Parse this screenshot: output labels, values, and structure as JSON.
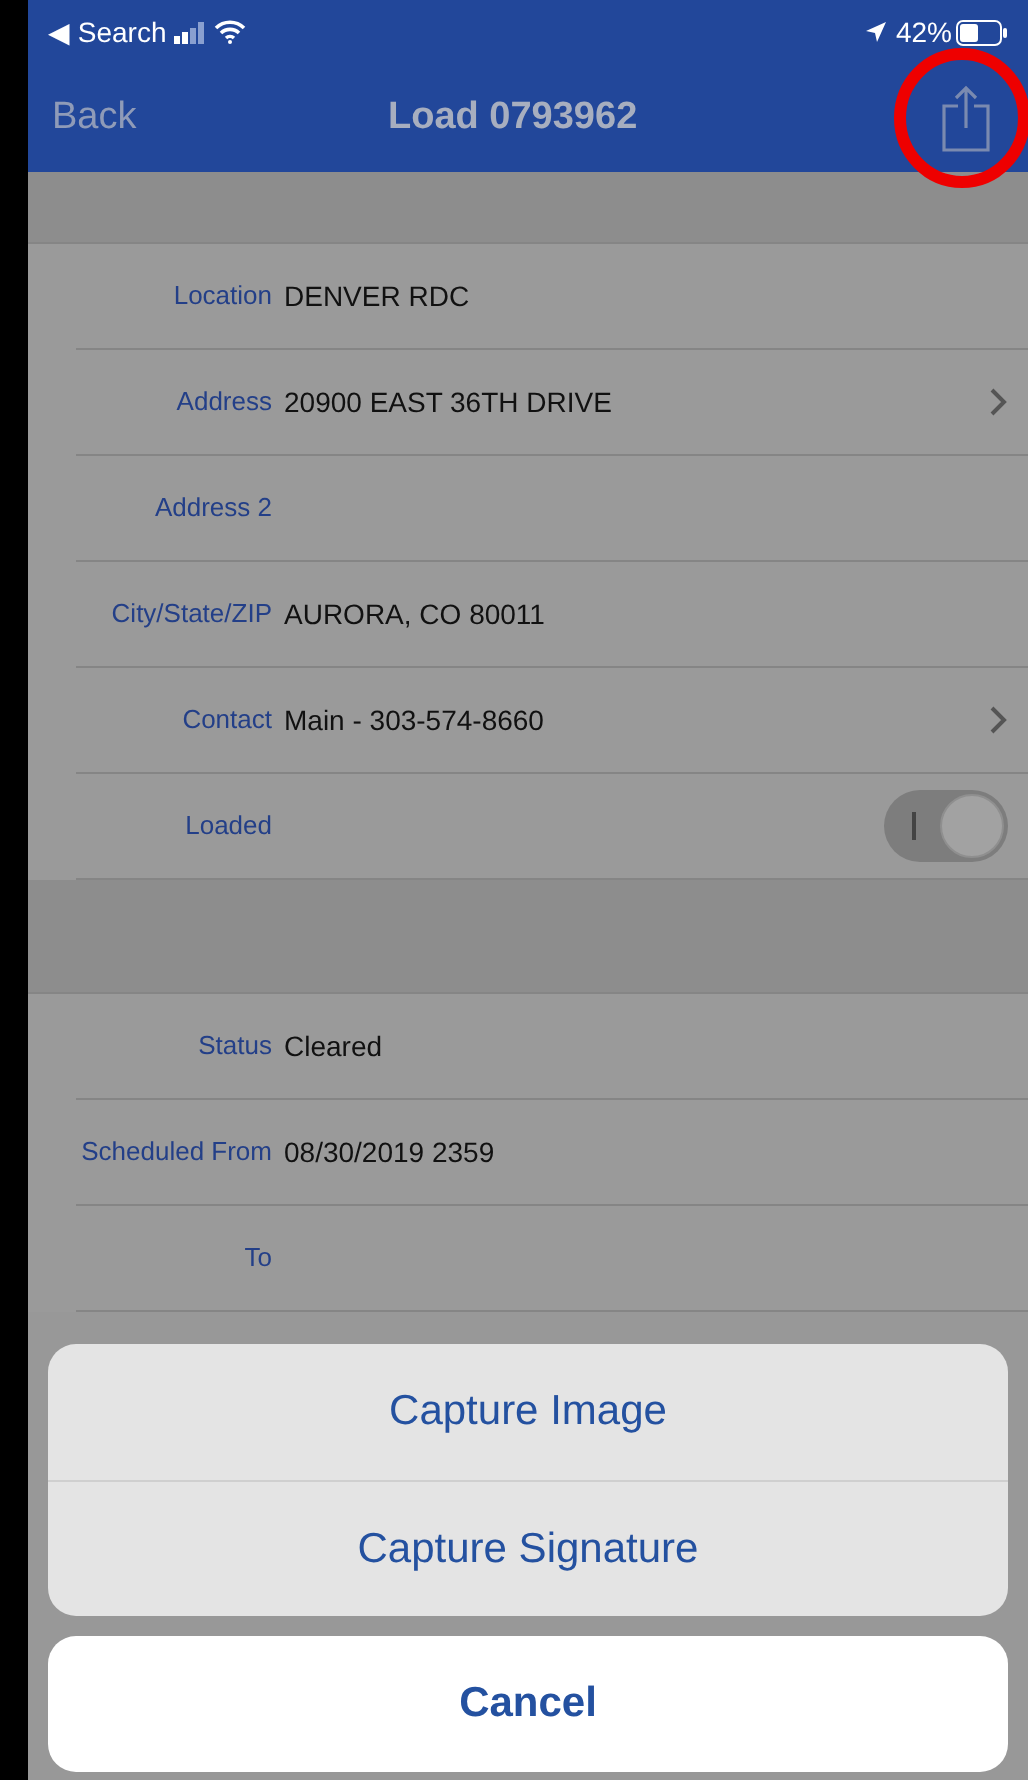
{
  "status_bar": {
    "back_app": "◀ Search",
    "battery": "42%"
  },
  "nav": {
    "back": "Back",
    "title": "Load 0793962",
    "highlighted_share": true
  },
  "sections": [
    {
      "rows": [
        {
          "kind": "text",
          "label": "Location",
          "value": "DENVER RDC",
          "chevron": false
        },
        {
          "kind": "text",
          "label": "Address",
          "value": "20900 EAST 36TH DRIVE",
          "chevron": true
        },
        {
          "kind": "text",
          "label": "Address 2",
          "chevron": false
        },
        {
          "kind": "text",
          "label": "City/State/ZIP",
          "value": "AURORA, CO 80011",
          "chevron": false
        },
        {
          "kind": "text",
          "label": "Contact",
          "value": "Main - 303-574-8660",
          "chevron": true
        },
        {
          "kind": "toggle",
          "label": "Loaded",
          "on": true
        }
      ]
    },
    {
      "rows": [
        {
          "kind": "text",
          "label": "Status",
          "value": "Cleared",
          "chevron": false
        },
        {
          "kind": "text",
          "label": "Scheduled From",
          "value": "08/30/2019 2359",
          "chevron": false
        },
        {
          "kind": "text",
          "label": "To",
          "chevron": false
        }
      ]
    }
  ],
  "action_sheet": {
    "actions": [
      "Capture Image",
      "Capture Signature"
    ],
    "cancel": "Cancel"
  }
}
